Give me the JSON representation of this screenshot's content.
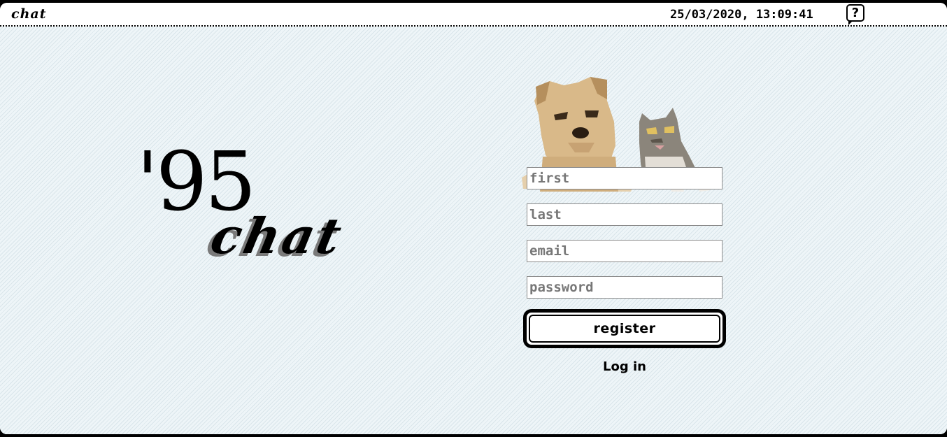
{
  "menubar": {
    "app_name": "chat",
    "datetime": "25/03/2020, 13:09:41",
    "help_label": "?"
  },
  "logo": {
    "number": "'95",
    "word": "chat"
  },
  "form": {
    "first_placeholder": "first",
    "last_placeholder": "last",
    "email_placeholder": "email",
    "password_placeholder": "password",
    "register_label": "register",
    "login_label": "Log in"
  },
  "illustration": {
    "subjects": [
      "dog",
      "cat"
    ]
  }
}
